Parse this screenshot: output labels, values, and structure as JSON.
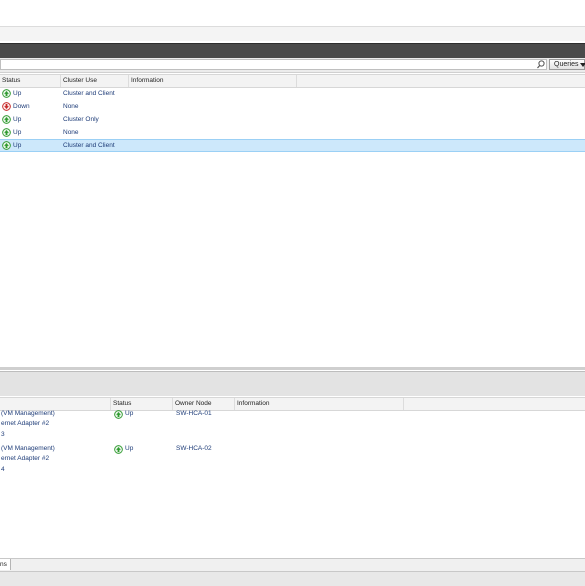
{
  "colors": {
    "up": "#2f9a2f",
    "down": "#c62828",
    "selection": "#cde8fb",
    "link_text": "#1e3c78"
  },
  "filter": {
    "queries_label": "Queries",
    "search_icon": "search-icon"
  },
  "networks_grid": {
    "columns": [
      "Status",
      "Cluster Use",
      "Information"
    ],
    "rows": [
      {
        "status": "Up",
        "status_icon": "up-arrow-icon",
        "use": "Cluster and Client",
        "selected": false
      },
      {
        "status": "Down",
        "status_icon": "down-arrow-icon",
        "use": "None",
        "selected": false
      },
      {
        "status": "Up",
        "status_icon": "up-arrow-icon",
        "use": "Cluster Only",
        "selected": false
      },
      {
        "status": "Up",
        "status_icon": "up-arrow-icon",
        "use": "None",
        "selected": false
      },
      {
        "status": "Up",
        "status_icon": "up-arrow-icon",
        "use": "Cluster and Client",
        "selected": true
      }
    ]
  },
  "connections_grid": {
    "columns": [
      "Status",
      "Owner Node",
      "Information"
    ],
    "rows": [
      {
        "name_line1": "(VM Management)",
        "name_line2": "ernet Adapter #2",
        "name_line3": "3",
        "status": "Up",
        "owner": "SW-HCA-01"
      },
      {
        "name_line1": "(VM Management)",
        "name_line2": "ernet Adapter #2",
        "name_line3": "4",
        "status": "Up",
        "owner": "SW-HCA-02"
      }
    ]
  },
  "bottom_tabs": [
    {
      "label": "ns"
    }
  ]
}
